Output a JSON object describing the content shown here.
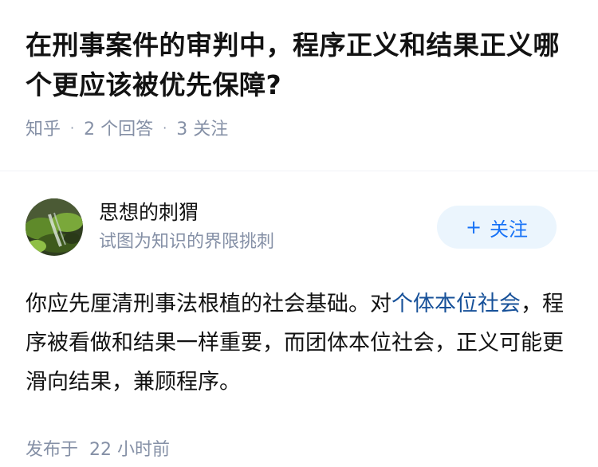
{
  "question": {
    "title": "在刑事案件的审判中，程序正义和结果正义哪个更应该被优先保障?",
    "source": "知乎",
    "answers_count": "2 个回答",
    "followers_count": "3 关注"
  },
  "answer": {
    "author": {
      "name": "思想的刺猬",
      "bio": "试图为知识的界限挑刺",
      "avatar_icon": "moss-rocks-avatar"
    },
    "follow_button": {
      "icon": "+",
      "label": "关注"
    },
    "content": {
      "part1": "你应先厘清刑事法根植的社会基础。对",
      "link": "个体本位社会",
      "part2": "，程序被看做和结果一样重要，而团体本位社会，正义可能更滑向结果，兼顾程序。"
    },
    "footer": {
      "published_label": "发布于",
      "time": "22 小时前"
    }
  },
  "colors": {
    "link": "#175199",
    "follow_bg": "#ebf5fd",
    "follow_text": "#1772f6",
    "meta": "#8590a6"
  }
}
